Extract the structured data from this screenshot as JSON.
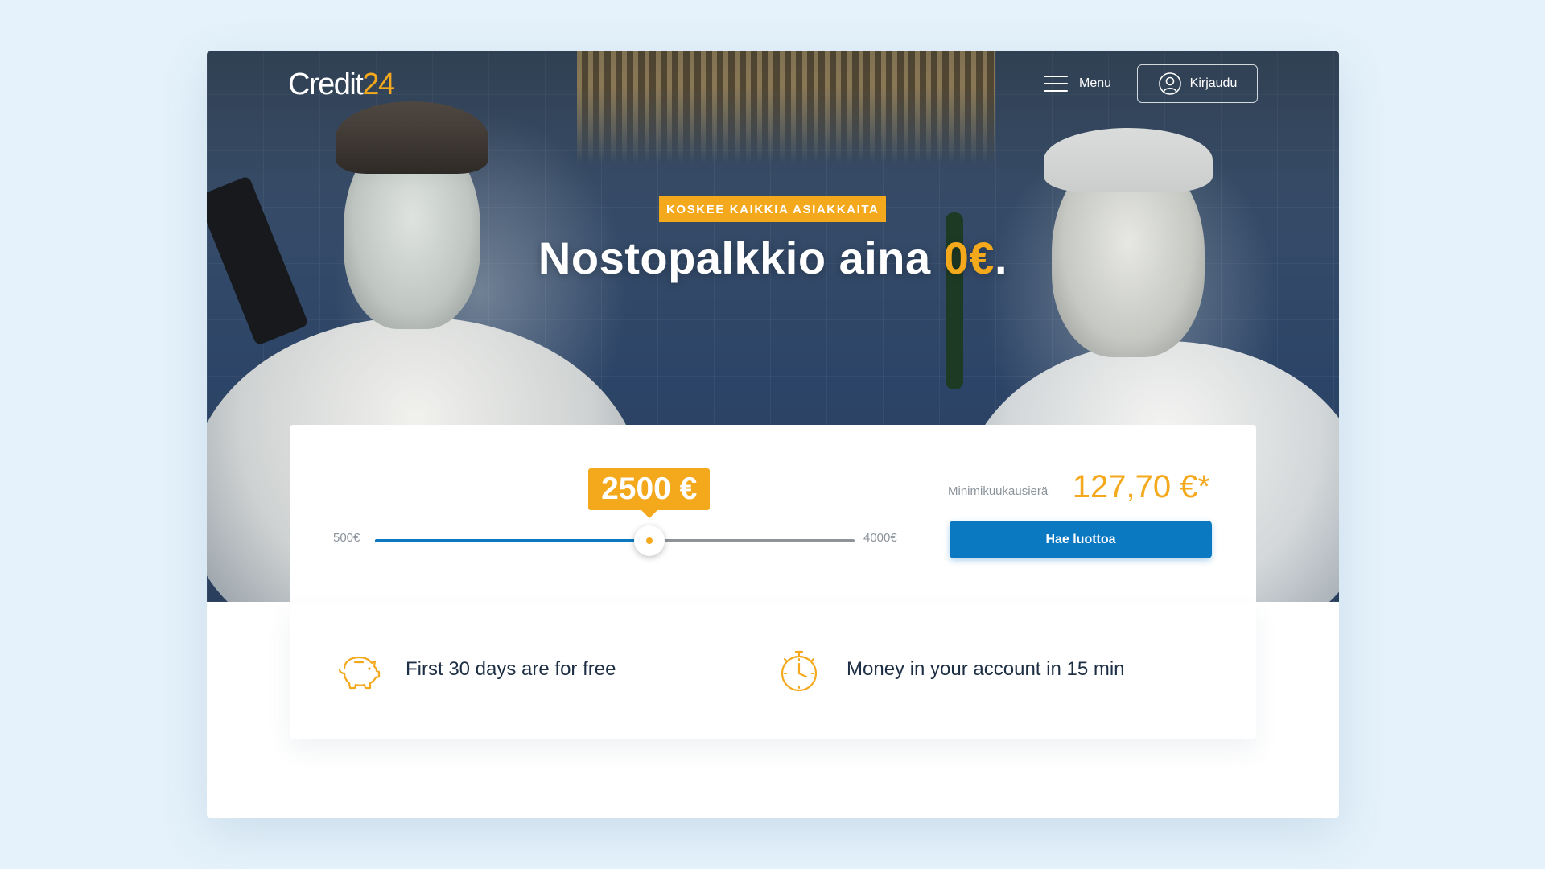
{
  "header": {
    "logo_part1": "Credit",
    "logo_part2": "24",
    "menu_label": "Menu",
    "login_label": "Kirjaudu"
  },
  "hero": {
    "badge": "KOSKEE KAIKKIA ASIAKKAITA",
    "headline_prefix": "Nostopalkkio aina ",
    "headline_accent": "0€",
    "headline_suffix": "."
  },
  "calculator": {
    "amount_label": "2500 €",
    "slider_min_label": "500€",
    "slider_max_label": "4000€",
    "slider_min": 500,
    "slider_max": 4000,
    "slider_value": 2500,
    "min_payment_label": "Minimikuukausierä",
    "min_payment_value": "127,70 €*",
    "apply_button": "Hae luottoa"
  },
  "features": [
    {
      "icon": "piggy-bank-icon",
      "text": "First 30 days are for free"
    },
    {
      "icon": "stopwatch-icon",
      "text": "Money in your account in 15 min"
    }
  ],
  "colors": {
    "accent": "#f4a81c",
    "primary": "#0b78c2",
    "background": "#e5f2fb",
    "text_dark": "#1d2f45"
  }
}
